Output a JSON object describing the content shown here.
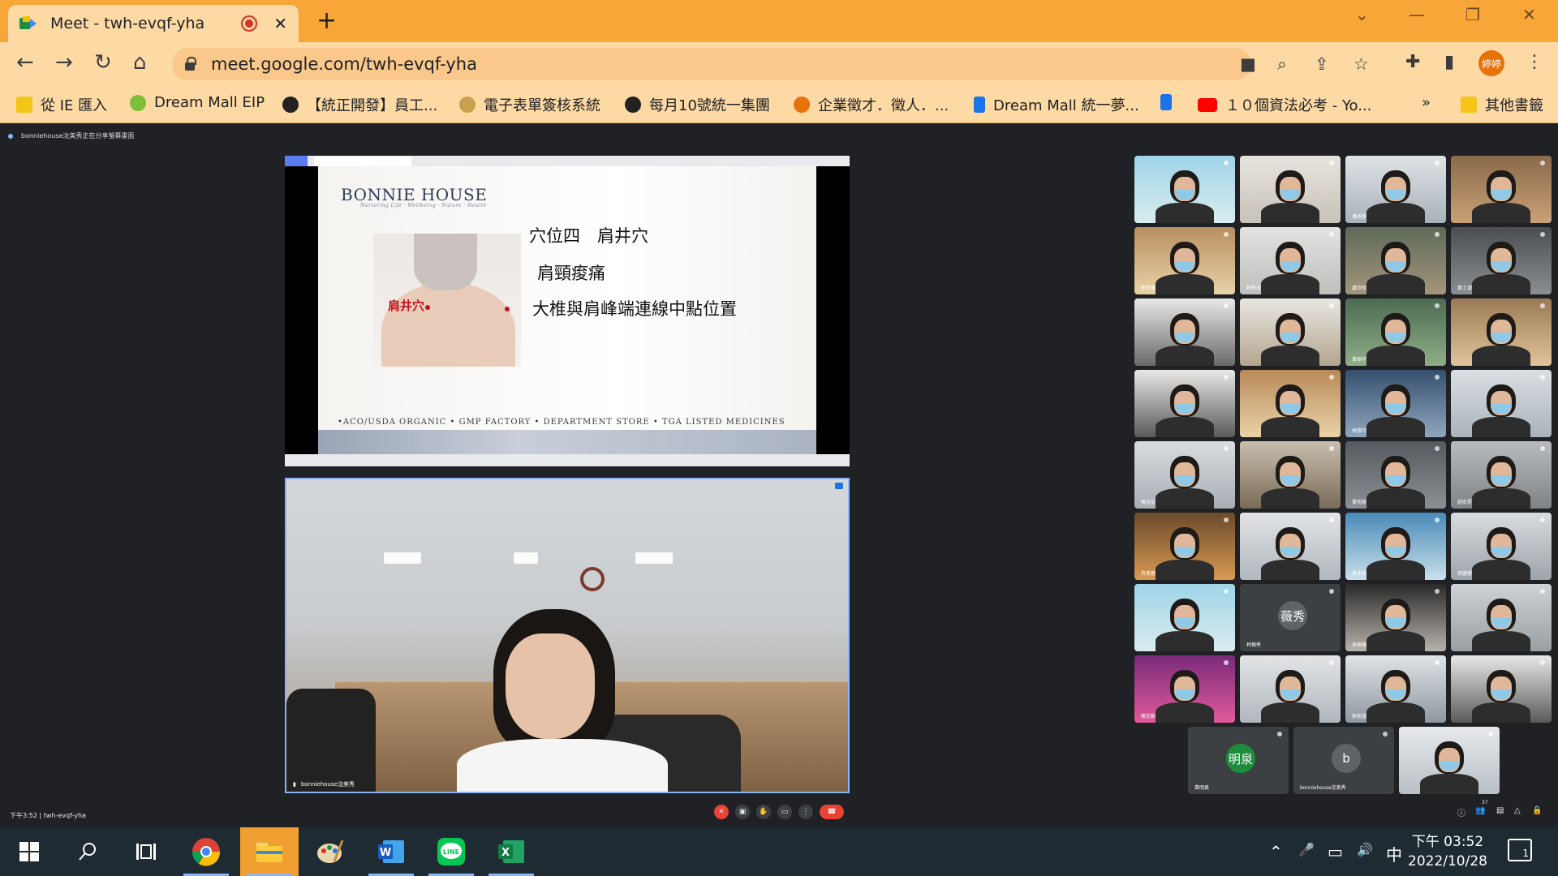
{
  "browser": {
    "tab_title": "Meet - twh-evqf-yha",
    "tab_close": "✕",
    "new_tab": "+",
    "url": "meet.google.com/twh-evqf-yha",
    "profile_label": "婷婷",
    "accent": "#f7a637",
    "window": {
      "minimize": "—",
      "restore": "❐",
      "close": "✕",
      "tablist": "⌄"
    },
    "nav": {
      "back": "←",
      "forward": "→",
      "reload": "↻",
      "home": "⌂"
    },
    "omni_icons": {
      "camera": "■",
      "zoom": "⌕",
      "share": "⇪",
      "star": "☆"
    },
    "ext_icons": {
      "puzzle": "✚",
      "sidepanel": "▮",
      "menu": "⋮"
    }
  },
  "bookmarks": {
    "items": [
      {
        "label": "從 IE 匯入",
        "color": "#f5c518"
      },
      {
        "label": "Dream Mall EIP",
        "color": "#7cbf3a"
      },
      {
        "label": "【統正開發】員工...",
        "color": "#222222"
      },
      {
        "label": "電子表單簽核系統",
        "color": "#c9a04d"
      },
      {
        "label": "每月10號統一集團",
        "color": "#222222"
      },
      {
        "label": "企業徵才．徵人．...",
        "color": "#e8710a"
      },
      {
        "label": "Dream Mall 統一夢...",
        "color": "#1a73e8"
      },
      {
        "label": "",
        "color": "#1a73e8"
      },
      {
        "label": "１０個資法必考 - Yo...",
        "color": "#ff0000"
      }
    ],
    "more": "»",
    "other": "其他書籤"
  },
  "meet": {
    "share_banner": "bonniehouse沈美秀正在分享螢幕畫面",
    "slide": {
      "logo": "BONNIE HOUSE",
      "tagline": "Nurturing Life · Wellbeing · Nature · Health",
      "body_label": "肩井穴",
      "line1": "穴位四　肩井穴",
      "line2": "肩頸痠痛",
      "line3": "大椎與肩峰端連線中點位置",
      "footer": "•ACO/USDA ORGANIC  •  GMP FACTORY  •  DEPARTMENT STORE  •  TGA LISTED MEDICINES"
    },
    "speaker_name": "bonniehouse沈美秀",
    "meeting_info": "下午3:52  |  twh-evqf-yha",
    "tiles": [
      {
        "name": ""
      },
      {
        "name": ""
      },
      {
        "name": "潘佩華"
      },
      {
        "name": ""
      },
      {
        "name": "廖美華"
      },
      {
        "name": "林秀玉"
      },
      {
        "name": "盧欣怡"
      },
      {
        "name": "黃士源"
      },
      {
        "name": ""
      },
      {
        "name": ""
      },
      {
        "name": "黃振宇"
      },
      {
        "name": ""
      },
      {
        "name": ""
      },
      {
        "name": ""
      },
      {
        "name": "林惠玲"
      },
      {
        "name": ""
      },
      {
        "name": "陳志宏"
      },
      {
        "name": ""
      },
      {
        "name": "黃明泉"
      },
      {
        "name": "趙宏昇"
      },
      {
        "name": "許美蓉"
      },
      {
        "name": ""
      },
      {
        "name": "吳幸怡"
      },
      {
        "name": "張麗蓉"
      },
      {
        "name": ""
      },
      {
        "name": "柯薇秀"
      },
      {
        "name": "吳佩珊"
      },
      {
        "name": ""
      },
      {
        "name": "陳志勳"
      },
      {
        "name": ""
      },
      {
        "name": "郭宛誼"
      },
      {
        "name": ""
      },
      {
        "name": "黃明泉"
      },
      {
        "name": "bonniehouse沈美秀"
      },
      {
        "name": ""
      }
    ],
    "avatars": {
      "weixiu": {
        "initials": "薇秀",
        "color": "#5f6368"
      },
      "mingquan": {
        "initials": "明泉",
        "color": "#1e8e3e"
      },
      "bonnie": {
        "initials": "b",
        "color": "#5f6368"
      }
    },
    "controls": {
      "mic": "✕",
      "camera": "▣",
      "hand": "✋",
      "present": "▭",
      "more": "⋮",
      "end": "☎"
    },
    "right_controls": {
      "info": "ⓘ",
      "people": "👥",
      "people_count": "37",
      "chat": "▤",
      "activities": "△",
      "lock": "🔒"
    }
  },
  "taskbar": {
    "clock_time": "下午 03:52",
    "clock_date": "2022/10/28",
    "ime": "中",
    "notifications": "1",
    "tray": {
      "chevron": "⌃",
      "mic": "🎤",
      "battery": "▭",
      "volume": "🔊"
    }
  }
}
